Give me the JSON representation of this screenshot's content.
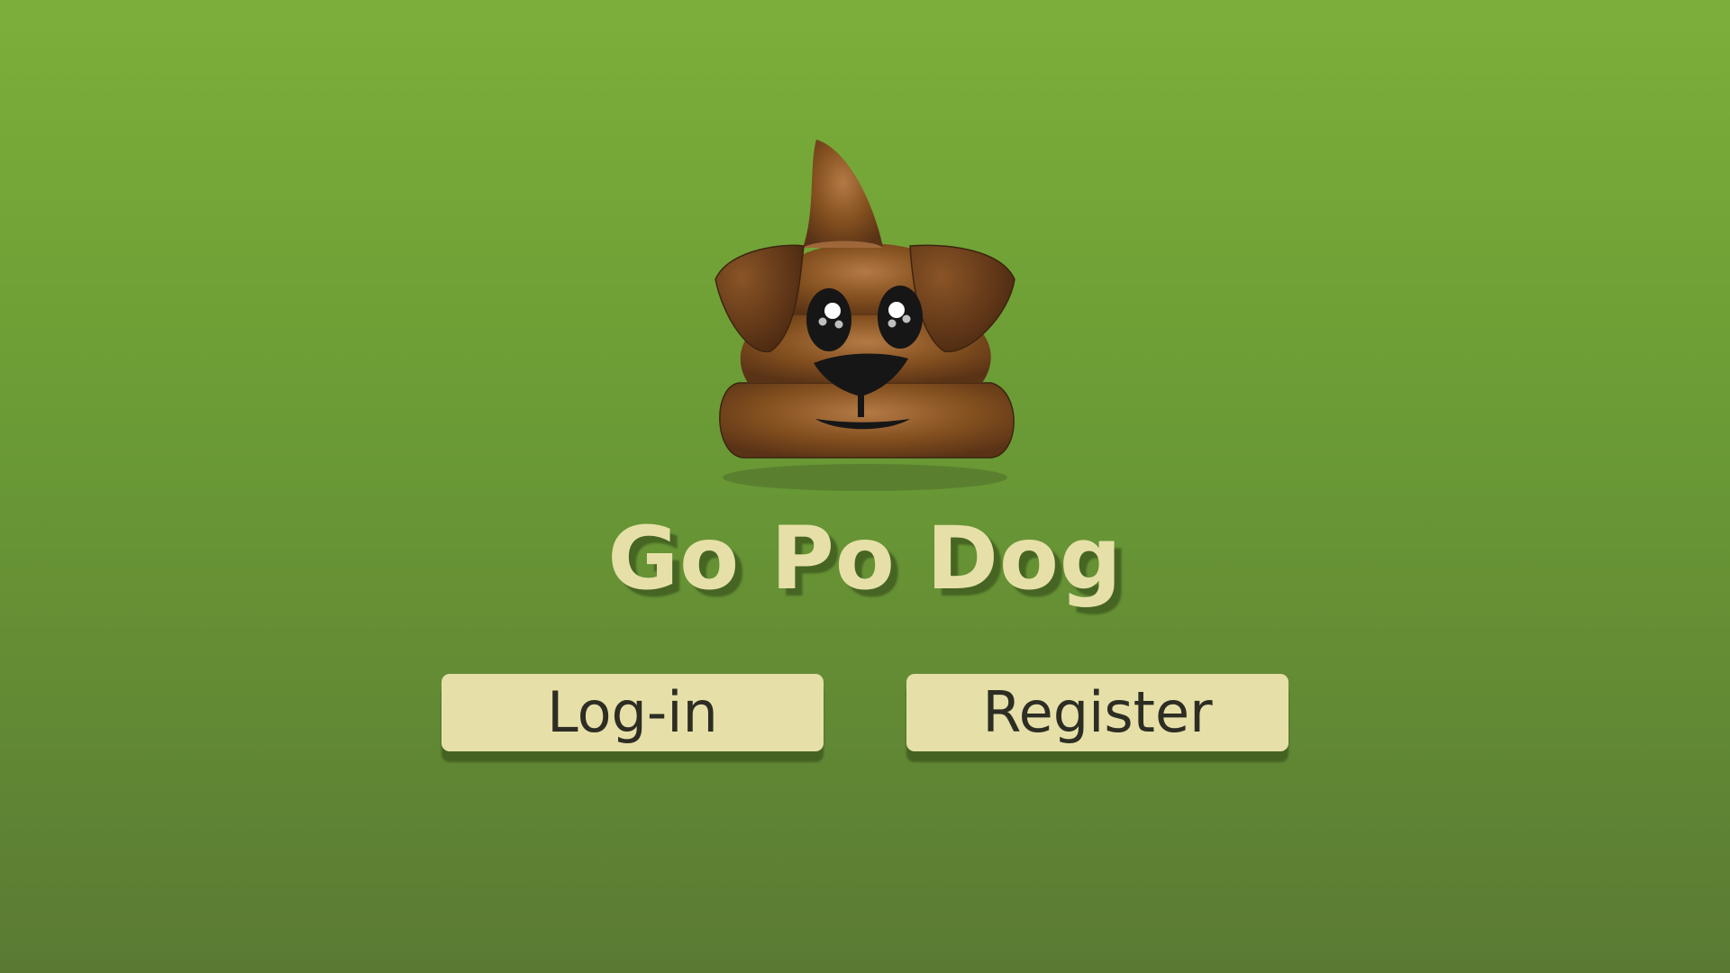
{
  "app": {
    "title": "Go Po Dog",
    "logo_icon": "poop-dog-icon"
  },
  "actions": {
    "login_label": "Log-in",
    "register_label": "Register"
  },
  "colors": {
    "background_top": "#7caf3a",
    "background_bottom": "#5a7a33",
    "accent": "#e6e0a8",
    "button_text": "#2d2d24",
    "logo_brown": "#7a4a22"
  }
}
